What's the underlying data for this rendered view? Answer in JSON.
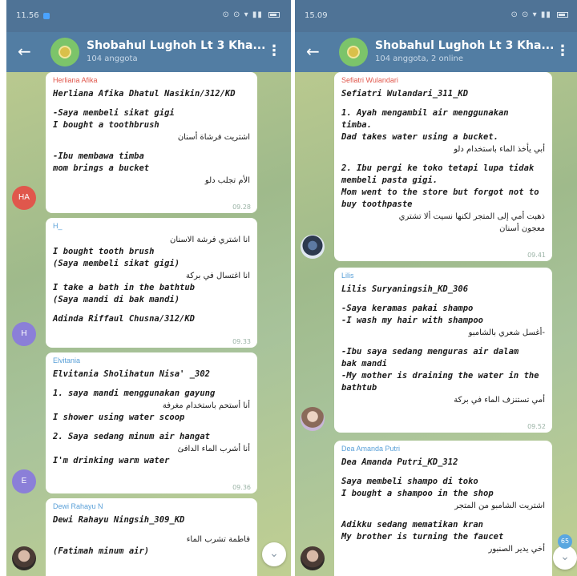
{
  "colors": {
    "header": "#527da3",
    "statusbar": "#4f7396",
    "bubble": "#ffffff",
    "chat_bg": "#a9bf8c"
  },
  "left": {
    "status": {
      "time": "11.56"
    },
    "header": {
      "title": "Shobahul Lughoh Lt 3 Kha...",
      "subtitle": "104 anggota"
    },
    "messages": [
      {
        "sender": "Herliana Afika",
        "sender_color": "#e0574c",
        "lines": [
          "Herliana Afika Dhatul Nasikin/312/KD",
          "",
          "-Saya membeli sikat gigi",
          " I bought a toothbrush",
          "اشتريت فرشاة أسنان",
          "",
          "-Ibu membawa timba",
          "  mom brings a bucket",
          "الأم تجلب دلو"
        ],
        "rtl": [
          4,
          8
        ],
        "time": "09.28",
        "avatar": "HA"
      },
      {
        "sender": "H_",
        "sender_color": "#5aa0d8",
        "lines": [
          "انا اشتري فرشة الاسنان",
          "I bought tooth brush",
          "(Saya membeli sikat gigi)",
          "انا اغتسال في بركة",
          "I take a bath in the bathtub",
          "(Saya mandi di bak mandi)",
          "",
          "Adinda Riffaul Chusna/312/KD"
        ],
        "rtl": [
          0,
          3
        ],
        "time": "09.33",
        "avatar": "H"
      },
      {
        "sender": "Elvitania",
        "sender_color": "#5aa0d8",
        "lines": [
          "Elvitania Sholihatun Nisa' _302",
          "",
          "1. saya mandi menggunakan gayung",
          "أنا أستحم باستخدام مغرفة",
          "I shower using water scoop",
          "",
          "2. Saya sedang minum air hangat",
          "أنا أشرب الماء الدافئ",
          "I'm drinking warm water"
        ],
        "rtl": [
          3,
          7
        ],
        "time": "09.36",
        "avatar": "E"
      },
      {
        "sender": "Dewi Rahayu N",
        "sender_color": "#5aa0d8",
        "lines": [
          "Dewi Rahayu Ningsih_309_KD",
          "",
          "فاطمة تشرب الماء",
          "(Fatimah minum air)"
        ],
        "rtl": [
          2
        ],
        "time": ""
      }
    ]
  },
  "right": {
    "status": {
      "time": "15.09"
    },
    "header": {
      "title": "Shobahul Lughoh Lt 3 Kha...",
      "subtitle": "104 anggota, 2 online"
    },
    "messages": [
      {
        "sender": "Sefiatri Wulandari",
        "sender_color": "#e0574c",
        "lines": [
          "Sefiatri Wulandari_311_KD",
          "",
          "1. Ayah mengambil air menggunakan",
          "timba.",
          "Dad takes water using a bucket.",
          "أبي يأخذ الماء باستخدام دلو",
          "",
          "2. Ibu pergi ke toko tetapi lupa tidak",
          "membeli pasta gigi.",
          "Mom went to the store but forgot not to",
          "buy toothpaste",
          "ذهبت أمي إلى المتجر لكنها نسيت ألا تشتري",
          "معجون أسنان"
        ],
        "rtl": [
          5,
          11,
          12
        ],
        "time": "09.41"
      },
      {
        "sender": "Lilis",
        "sender_color": "#5aa0d8",
        "lines": [
          "Lilis Suryaningsih_KD_306",
          "",
          "-Saya keramas pakai shampo",
          "-I wash my hair with shampoo",
          "أغسل شعري بالشامبو-",
          "",
          "-Ibu saya sedang menguras air dalam",
          "bak mandi",
          "-My mother is draining the water in the",
          "bathtub",
          "أمي تستنزف الماء في بركة"
        ],
        "rtl": [
          4,
          10
        ],
        "time": "09.52"
      },
      {
        "sender": "Dea Amanda Putri",
        "sender_color": "#5aa0d8",
        "lines": [
          "Dea Amanda Putri_KD_312",
          "",
          "Saya membeli shampo di toko",
          "I bought a shampoo in the shop",
          "اشتريت الشامبو من المتجر",
          "",
          "Adikku sedang mematikan kran",
          "My brother is turning the faucet",
          "أخي يدير الصنبور"
        ],
        "rtl": [
          4,
          8
        ],
        "time": ""
      }
    ],
    "badge": "65"
  }
}
